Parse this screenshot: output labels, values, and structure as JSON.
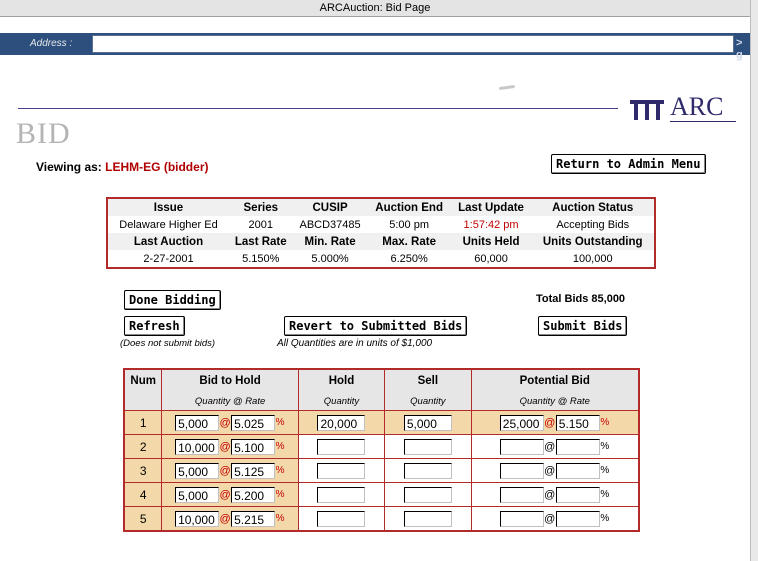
{
  "window": {
    "title": "ARCAuction: Bid Page"
  },
  "address_bar": {
    "label": "Address :",
    "value": "",
    "go": "> g"
  },
  "logo": {
    "text": "ARC"
  },
  "page": {
    "title": "BID",
    "viewing_label": "Viewing as:",
    "viewing_user": "LEHM-EG (bidder)",
    "return_button": "Return to Admin Menu"
  },
  "info_table": {
    "headers1": [
      "Issue",
      "Series",
      "CUSIP",
      "Auction End",
      "Last Update",
      "Auction Status"
    ],
    "values1": [
      "Delaware Higher Ed",
      "2001",
      "ABCD37485",
      "5:00 pm",
      "1:57:42 pm",
      "Accepting Bids"
    ],
    "headers2": [
      "Last Auction",
      "Last Rate",
      "Min. Rate",
      "Max. Rate",
      "Units Held",
      "Units Outstanding"
    ],
    "values2": [
      "2-27-2001",
      "5.150%",
      "5.000%",
      "6.250%",
      "60,000",
      "100,000"
    ]
  },
  "controls": {
    "done_button": "Done Bidding",
    "total_bids": "Total Bids 85,000",
    "refresh_button": "Refresh",
    "refresh_note": "(Does not submit bids)",
    "revert_button": "Revert to Submitted Bids",
    "units_note": "All Quantities are in units of $1,000",
    "submit_button": "Submit Bids"
  },
  "bid_table": {
    "headers": {
      "num": "Num",
      "bid": "Bid to Hold",
      "hold": "Hold",
      "sell": "Sell",
      "potential": "Potential Bid"
    },
    "subheaders": {
      "bid": "Quantity @ Rate",
      "hold": "Quantity",
      "sell": "Quantity",
      "potential": "Quantity @ Rate"
    },
    "at": "@",
    "percent": "%",
    "rows": [
      {
        "num": "1",
        "bid_qty": "5,000",
        "bid_rate": "5.025",
        "hold": "20,000",
        "sell": "5,000",
        "pot_qty": "25,000",
        "pot_rate": "5.150"
      },
      {
        "num": "2",
        "bid_qty": "10,000",
        "bid_rate": "5.100",
        "hold": "",
        "sell": "",
        "pot_qty": "",
        "pot_rate": ""
      },
      {
        "num": "3",
        "bid_qty": "5,000",
        "bid_rate": "5.125",
        "hold": "",
        "sell": "",
        "pot_qty": "",
        "pot_rate": ""
      },
      {
        "num": "4",
        "bid_qty": "5,000",
        "bid_rate": "5.200",
        "hold": "",
        "sell": "",
        "pot_qty": "",
        "pot_rate": ""
      },
      {
        "num": "5",
        "bid_qty": "10,000",
        "bid_rate": "5.215",
        "hold": "",
        "sell": "",
        "pot_qty": "",
        "pot_rate": ""
      }
    ]
  }
}
